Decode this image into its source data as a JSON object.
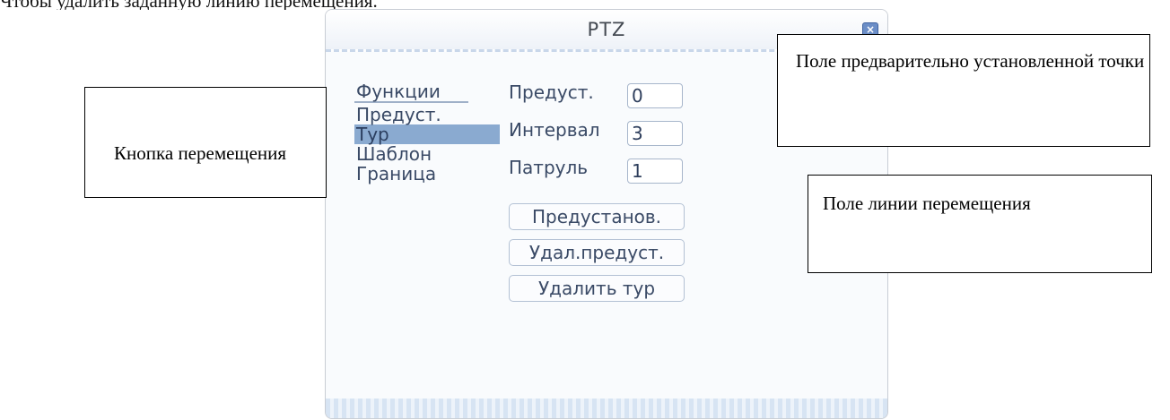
{
  "document": {
    "top_line": "Чтобы удалить заданную линию перемещения."
  },
  "dialog": {
    "title": "PTZ",
    "close_icon": "close-icon"
  },
  "menu": {
    "items": [
      {
        "label": "Функции",
        "selected": false
      },
      {
        "label": "Предуст.",
        "selected": false
      },
      {
        "label": "Тур",
        "selected": true
      },
      {
        "label": "Шаблон",
        "selected": false
      },
      {
        "label": "Граница",
        "selected": false
      }
    ]
  },
  "fields": {
    "preset": {
      "label": "Предуст.",
      "value": "0"
    },
    "interval": {
      "label": "Интервал",
      "value": "3"
    },
    "patrol": {
      "label": "Патруль",
      "value": "1"
    }
  },
  "buttons": {
    "set_preset": "Предустанов.",
    "delete_preset": "Удал.предуст.",
    "delete_tour": "Удалить тур"
  },
  "callouts": {
    "move_button": "Кнопка перемещения",
    "preset_field": "Поле предварительно установленной точки",
    "line_field": "Поле линии перемещения"
  }
}
